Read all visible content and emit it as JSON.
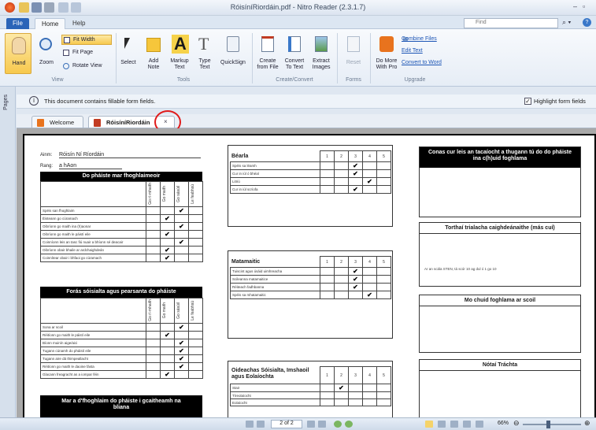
{
  "app": {
    "title": "RóisíníRiordáin.pdf - Nitro Reader (2.3.1.7)",
    "tabs": {
      "file": "File",
      "home": "Home",
      "help": "Help"
    },
    "find_placeholder": "Find"
  },
  "ribbon": {
    "hand": "Hand",
    "zoom": "Zoom",
    "fit_width": "Fit Width",
    "fit_page": "Fit Page",
    "rotate_view": "Rotate View",
    "select": "Select",
    "add_note": "Add\nNote",
    "markup_text": "Markup\nText",
    "type_text": "Type\nText",
    "quicksign": "QuickSign",
    "create_from_file": "Create\nfrom File",
    "convert_to_text": "Convert\nTo Text",
    "extract_images": "Extract\nImages",
    "reset": "Reset",
    "do_more": "Do More\nWith Pro",
    "combine_files": "Combine Files",
    "edit_text": "Edit Text",
    "convert_to_word": "Convert to Word",
    "groups": {
      "view": "View",
      "tools": "Tools",
      "create_convert": "Create/Convert",
      "forms": "Forms",
      "upgrade": "Upgrade"
    }
  },
  "sidebar": {
    "pages_label": "Pages"
  },
  "infobar": {
    "message": "This document contains fillable form fields.",
    "highlight_label": "Highlight form fields",
    "highlight_checked": true
  },
  "doc_tabs": [
    {
      "label": "Welcome"
    },
    {
      "label": "RóisíníRiordáin",
      "active": true
    }
  ],
  "document": {
    "name_label": "Ainm:",
    "name_value": "Róisín Ní Ríordáin",
    "class_label": "Rang:",
    "class_value": "a hAon",
    "col_headers": [
      "Go rí-mhaith",
      "Go maith",
      "Go sásúil",
      "Le feabhsú"
    ],
    "section1": {
      "title": "Do pháiste mar fhoghlaimeoir",
      "rows": [
        {
          "label": "Spéis san fhoghlaim",
          "check": 3
        },
        {
          "label": "Éisteann go cúramach",
          "check": 2
        },
        {
          "label": "Oibríonn go maith ina (h)aonar",
          "check": 3
        },
        {
          "label": "Oibríonn go maith le páistí eile",
          "check": 2
        },
        {
          "label": "Coinníonn leis an tasc fiú nuair a bhíonn sé deacair",
          "check": 3
        },
        {
          "label": "Oibríonn obair bhaile ar ardchaighdeán",
          "check": 2
        },
        {
          "label": "Coinnítear obair i bhfaoi go cúramach",
          "check": 2
        }
      ]
    },
    "section2": {
      "title": "Forás sóisialta agus pearsanta do pháiste",
      "rows": [
        {
          "label": "Sona ar scoil",
          "check": 3
        },
        {
          "label": "Réitíonn go maith le páistí eile",
          "check": 2
        },
        {
          "label": "Bíonn muinín aige/aici",
          "check": 3
        },
        {
          "label": "Tugann cúnamh do pháistí eile",
          "check": 3
        },
        {
          "label": "Tugann aire dá thimpeallacht",
          "check": 3
        },
        {
          "label": "Réitíonn go maith le daoine fásta",
          "check": 3
        },
        {
          "label": "Glacann freagracht as a iompar féin",
          "check": 2
        }
      ]
    },
    "section3_title": "Mar a d'fhoghlaim do pháiste i gcaitheamh na bliana",
    "scale": [
      "1",
      "2",
      "3",
      "4",
      "5"
    ],
    "bearla": {
      "title": "Béarla",
      "rows": [
        {
          "label": "Spéis sa léamh",
          "check": 3
        },
        {
          "label": "Cur in iúl ó bhéal",
          "check": 3
        },
        {
          "label": "Litriú",
          "check": 4
        },
        {
          "label": "Cur in iúl scríofa",
          "check": 3
        }
      ]
    },
    "mata": {
      "title": "Matamaitic",
      "rows": [
        {
          "label": "Tuiscint agus úsáid uimhreacha",
          "check": 3
        },
        {
          "label": "Scileanna matamaitice",
          "check": 3
        },
        {
          "label": "Réiteach fadhbanna",
          "check": 3
        },
        {
          "label": "Spéis sa mhatamaitic",
          "check": 4
        }
      ]
    },
    "oideachas": {
      "title": "Oideachas Sóisialta, Imshaoil agus Eolaíochta",
      "rows": [
        {
          "label": "Stair",
          "check": 2
        },
        {
          "label": "Tíreolaíocht",
          "check": 0
        },
        {
          "label": "Eolaíocht",
          "check": 0
        }
      ]
    },
    "right": {
      "box1_title": "Conas cur leis an tacaíocht a thugann tú do do pháiste ina c(h)uid foghlama",
      "box2_title": "Torthaí trialacha caighdeánaithe (más cuí)",
      "box2_text": "Ar an scála STEN, tá scór 10 ag dul ó 1 go 10",
      "box3_title": "Mo chuid foghlama ar scoil",
      "box4_title": "Nótaí Tráchta"
    },
    "checkmark": "✔"
  },
  "status": {
    "page_indicator": "2 of 2",
    "zoom": "66%"
  },
  "colors": {
    "annotation": "#e01b1b",
    "file_tab": "#2b64b8"
  }
}
